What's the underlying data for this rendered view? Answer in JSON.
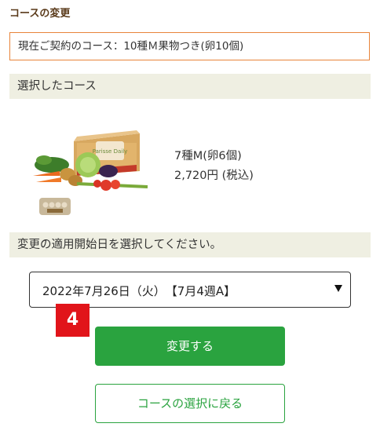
{
  "page": {
    "title": "コースの変更"
  },
  "current_course": {
    "text": "現在ご契約のコース：10種Ｍ果物つき(卵10個)"
  },
  "selected_section": {
    "heading": "選択したコース",
    "product_name": "7種M(卵6個)",
    "product_price": "2,720円 (税込)",
    "box_label": "Parisse Daily"
  },
  "start_date_section": {
    "heading": "変更の適用開始日を選択してください。",
    "selected_date": "2022年7月26日（火）　【7月4週A】",
    "step_number": "4"
  },
  "actions": {
    "change_label": "変更する",
    "back_label": "コースの選択に戻る"
  },
  "colors": {
    "accent_orange": "#e8843a",
    "section_bg": "#efefe2",
    "primary_green": "#2aa33f",
    "badge_red": "#e1141a"
  }
}
